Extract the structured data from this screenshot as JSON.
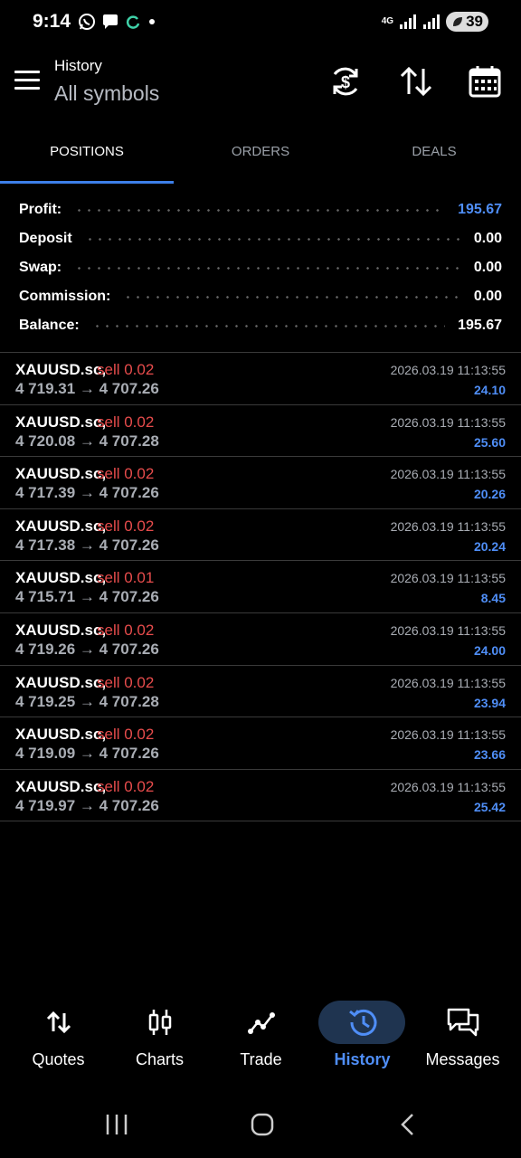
{
  "status_bar": {
    "time": "9:14",
    "network": "4G",
    "battery": "39",
    "icons": [
      "whatsapp-icon",
      "message-icon",
      "sync-icon",
      "dot-icon",
      "network-icon",
      "signal-icon",
      "battery-icon"
    ]
  },
  "header": {
    "subtitle": "History",
    "title": "All symbols",
    "actions": [
      "currency-exchange-icon",
      "sort-icon",
      "calendar-icon"
    ]
  },
  "tabs": [
    {
      "label": "POSITIONS",
      "active": true
    },
    {
      "label": "ORDERS",
      "active": false
    },
    {
      "label": "DEALS",
      "active": false
    }
  ],
  "summary": [
    {
      "label": "Profit:",
      "value": "195.67",
      "highlight": true
    },
    {
      "label": "Deposit",
      "value": "0.00",
      "highlight": false
    },
    {
      "label": "Swap:",
      "value": "0.00",
      "highlight": false
    },
    {
      "label": "Commission:",
      "value": "0.00",
      "highlight": false
    },
    {
      "label": "Balance:",
      "value": "195.67",
      "highlight": false
    }
  ],
  "positions": [
    {
      "symbol": "XAUUSD.sc,",
      "type": "sell 0.02",
      "prices": "4 719.31 → 4 707.26",
      "time": "2026.03.19 11:13:55",
      "profit": "24.10"
    },
    {
      "symbol": "XAUUSD.sc,",
      "type": "sell 0.02",
      "prices": "4 720.08 → 4 707.28",
      "time": "2026.03.19 11:13:55",
      "profit": "25.60"
    },
    {
      "symbol": "XAUUSD.sc,",
      "type": "sell 0.02",
      "prices": "4 717.39 → 4 707.26",
      "time": "2026.03.19 11:13:55",
      "profit": "20.26"
    },
    {
      "symbol": "XAUUSD.sc,",
      "type": "sell 0.02",
      "prices": "4 717.38 → 4 707.26",
      "time": "2026.03.19 11:13:55",
      "profit": "20.24"
    },
    {
      "symbol": "XAUUSD.sc,",
      "type": "sell 0.01",
      "prices": "4 715.71 → 4 707.26",
      "time": "2026.03.19 11:13:55",
      "profit": "8.45"
    },
    {
      "symbol": "XAUUSD.sc,",
      "type": "sell 0.02",
      "prices": "4 719.26 → 4 707.26",
      "time": "2026.03.19 11:13:55",
      "profit": "24.00"
    },
    {
      "symbol": "XAUUSD.sc,",
      "type": "sell 0.02",
      "prices": "4 719.25 → 4 707.28",
      "time": "2026.03.19 11:13:55",
      "profit": "23.94"
    },
    {
      "symbol": "XAUUSD.sc,",
      "type": "sell 0.02",
      "prices": "4 719.09 → 4 707.26",
      "time": "2026.03.19 11:13:55",
      "profit": "23.66"
    },
    {
      "symbol": "XAUUSD.sc,",
      "type": "sell 0.02",
      "prices": "4 719.97 → 4 707.26",
      "time": "2026.03.19 11:13:55",
      "profit": "25.42"
    }
  ],
  "bottom_nav": [
    {
      "label": "Quotes",
      "icon": "quotes-icon",
      "active": false
    },
    {
      "label": "Charts",
      "icon": "charts-icon",
      "active": false
    },
    {
      "label": "Trade",
      "icon": "trade-icon",
      "active": false
    },
    {
      "label": "History",
      "icon": "history-icon",
      "active": true
    },
    {
      "label": "Messages",
      "icon": "messages-icon",
      "active": false
    }
  ],
  "colors": {
    "accent": "#4f8ef7",
    "sell": "#e74c4c",
    "background": "#000000",
    "active_pill": "#1f3450"
  }
}
